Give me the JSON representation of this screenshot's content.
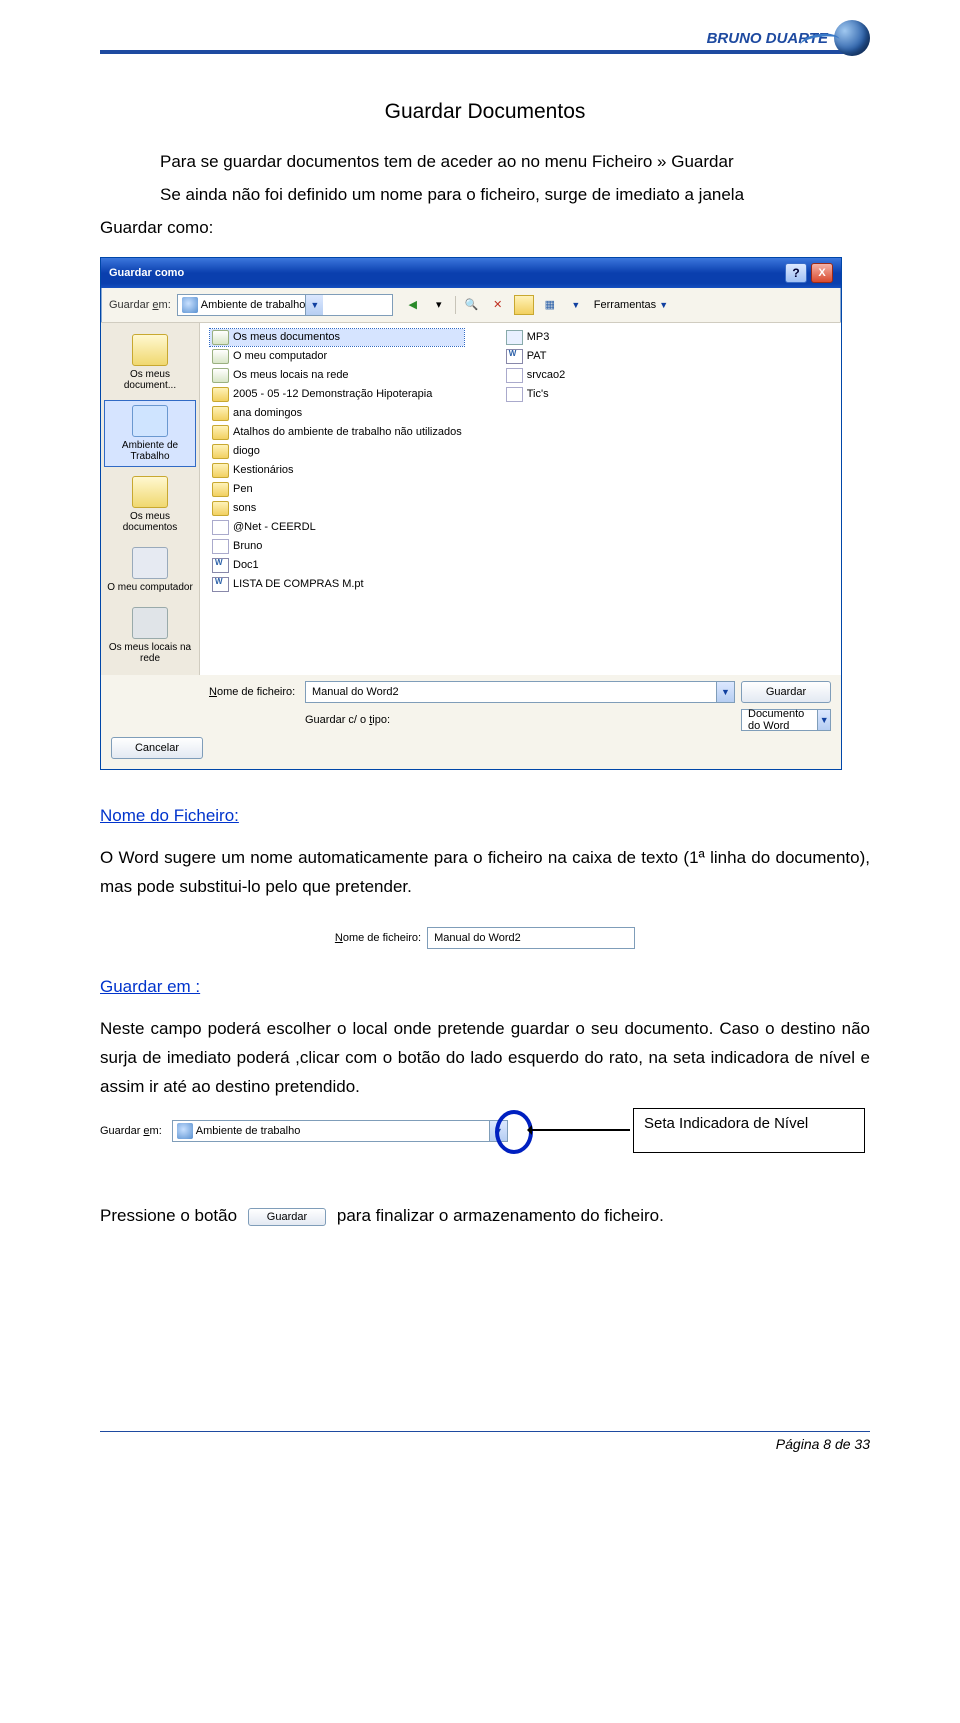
{
  "header": {
    "logo_text": "BRUNO DUARTE"
  },
  "title": "Guardar Documentos",
  "intro": {
    "line1": "Para se guardar documentos tem de aceder ao no menu Ficheiro » Guardar",
    "line2": "Se ainda não foi definido um nome para o ficheiro, surge de imediato a janela",
    "line3": "Guardar como:"
  },
  "dialog": {
    "title": "Guardar como",
    "help": "?",
    "close": "X",
    "toolbar": {
      "label_em": "Guardar em:",
      "location": "Ambiente de trabalho",
      "ferramentas": "Ferramentas"
    },
    "places": {
      "p1": "Os meus document...",
      "p2": "Ambiente de Trabalho",
      "p3": "Os meus documentos",
      "p4": "O meu computador",
      "p5": "Os meus locais na rede"
    },
    "files_left": [
      {
        "n": "Os meus documentos",
        "sel": true,
        "t": "sys"
      },
      {
        "n": "O meu computador",
        "t": "sys"
      },
      {
        "n": "Os meus locais na rede",
        "t": "sys"
      },
      {
        "n": "2005 - 05 -12 Demonstração Hipoterapia",
        "t": "folder"
      },
      {
        "n": "ana domingos",
        "t": "folder"
      },
      {
        "n": "Atalhos do ambiente de trabalho não utilizados",
        "t": "folder"
      },
      {
        "n": "diogo",
        "t": "folder"
      },
      {
        "n": "Kestionários",
        "t": "folder"
      },
      {
        "n": "Pen",
        "t": "folder"
      },
      {
        "n": "sons",
        "t": "folder"
      },
      {
        "n": "@Net - CEERDL",
        "t": "link"
      },
      {
        "n": "Bruno",
        "t": "link"
      },
      {
        "n": "Doc1",
        "t": "doc"
      },
      {
        "n": "LISTA DE COMPRAS M.pt",
        "t": "doc"
      }
    ],
    "files_right": [
      {
        "n": "MP3",
        "t": "snd"
      },
      {
        "n": "PAT",
        "t": "doc"
      },
      {
        "n": "srvcao2",
        "t": "link"
      },
      {
        "n": "Tic's",
        "t": "link"
      }
    ],
    "footer": {
      "nome_label": "Nome de ficheiro:",
      "nome_value": "Manual do Word2",
      "tipo_label": "Guardar c/ o tipo:",
      "tipo_value": "Documento do Word",
      "save": "Guardar",
      "cancel": "Cancelar"
    }
  },
  "sections": {
    "nome_link": "Nome do Ficheiro:",
    "nome_text": "O Word sugere um nome automaticamente para o ficheiro na caixa de texto (1ª linha do documento), mas pode substitui-lo pelo que pretender.",
    "crop_label": "Nome de ficheiro:",
    "crop_value": "Manual do Word2",
    "guardar_link": "Guardar em :",
    "guardar_text": "Neste campo poderá escolher o local onde pretende guardar o seu documento. Caso o destino não surja de imediato poderá ,clicar com o botão do lado esquerdo do rato, na seta indicadora de nível e assim ir até ao destino pretendido.",
    "row_label": "Guardar em:",
    "row_value": "Ambiente de trabalho",
    "nivel_box": "Seta Indicadora de Nível",
    "press1": "Pressione o botão",
    "press_btn": "Guardar",
    "press2": "para finalizar o armazenamento do ficheiro."
  },
  "footer": {
    "page": "Página 8 de 33"
  }
}
